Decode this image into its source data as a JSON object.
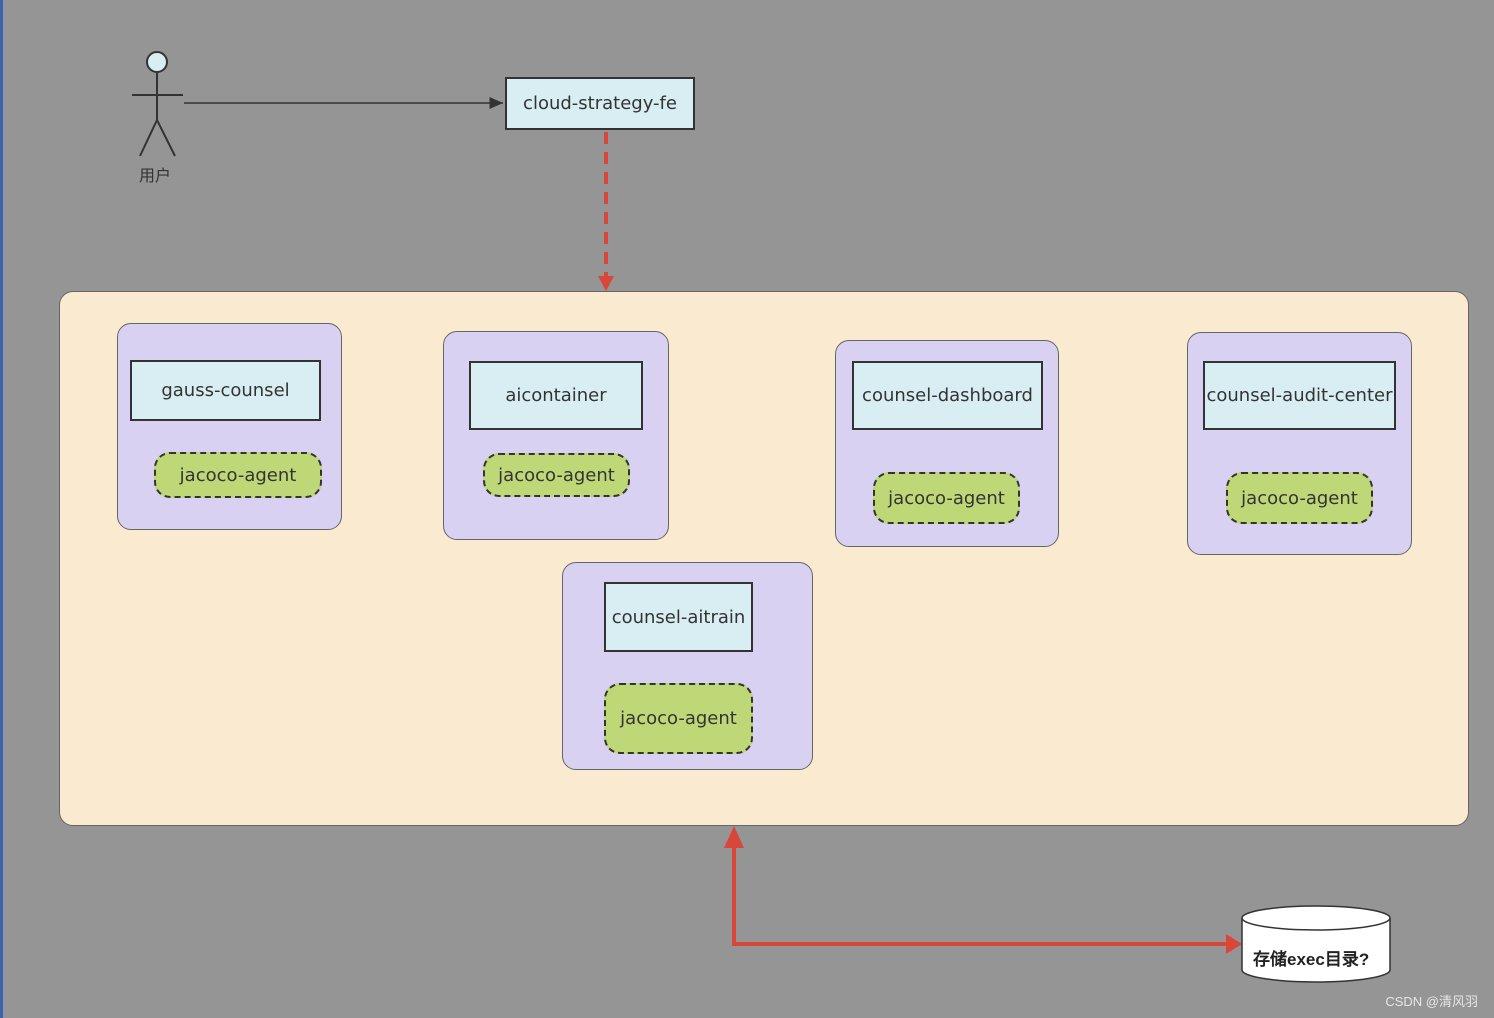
{
  "user": {
    "label": "用户"
  },
  "frontend": {
    "label": "cloud-strategy-fe"
  },
  "services": [
    {
      "name": "gauss-counsel",
      "agent": "jacoco-agent"
    },
    {
      "name": "aicontainer",
      "agent": "jacoco-agent"
    },
    {
      "name": "counsel-dashboard",
      "agent": "jacoco-agent"
    },
    {
      "name": "counsel-audit-center",
      "agent": "jacoco-agent"
    },
    {
      "name": "counsel-aitrain",
      "agent": "jacoco-agent"
    }
  ],
  "storage": {
    "label": "存储exec目录?"
  },
  "watermark": "CSDN @清风羽",
  "colors": {
    "background": "#959595",
    "panel": "#faebd0",
    "group": "#d9d1f2",
    "service_box": "#d8eef3",
    "agent": "#bfd877",
    "arrow_red": "#d9463a"
  }
}
